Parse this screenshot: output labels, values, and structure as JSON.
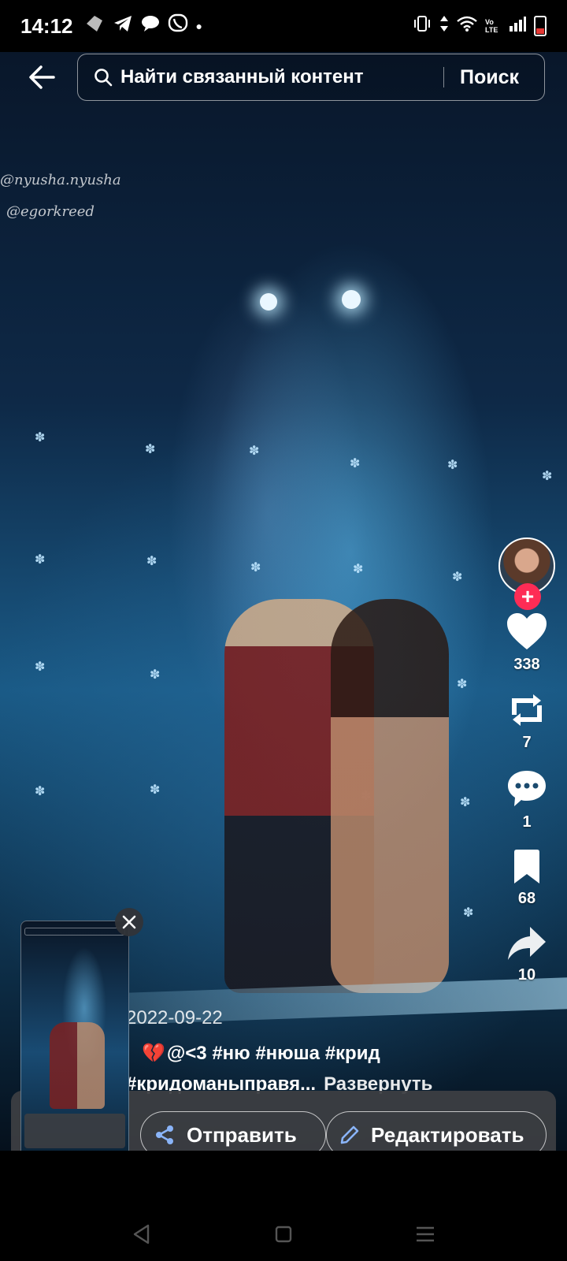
{
  "status_bar": {
    "time": "14:12",
    "left_icons": [
      "app-notification-icon",
      "telegram-icon",
      "chat-icon",
      "viber-icon",
      "dot-icon"
    ],
    "right_icons": [
      "vibrate-icon",
      "data-arrows-icon",
      "wifi-icon",
      "volte-icon",
      "signal-icon",
      "battery-low-icon"
    ],
    "volte_label": "Vo LTE"
  },
  "top_bar": {
    "back_icon": "arrow-left-icon",
    "search_placeholder": "Найти связанный контент",
    "search_button_label": "Поиск"
  },
  "video": {
    "watermarks": [
      "@nyusha.nyusha",
      "@egorkreed"
    ]
  },
  "rail": {
    "avatar_icon": "avatar",
    "follow_label": "+",
    "likes": "338",
    "reposts": "7",
    "comments": "1",
    "saves": "68",
    "shares": "10"
  },
  "caption": {
    "date": "2022-09-22",
    "line1": "@<3 #ню #нюша #крид",
    "line2": "#кридоманыправя...",
    "expand_label": "Развернуть",
    "emoji": "💔"
  },
  "share_sheet": {
    "send_label": "Отправить",
    "edit_label": "Редактировать"
  },
  "thumbnail": {
    "close_icon": "close-icon"
  },
  "colors": {
    "accent": "#fe2c55",
    "sheet_bg": "#3c3e42",
    "icon_blue": "#8ab4f8"
  }
}
